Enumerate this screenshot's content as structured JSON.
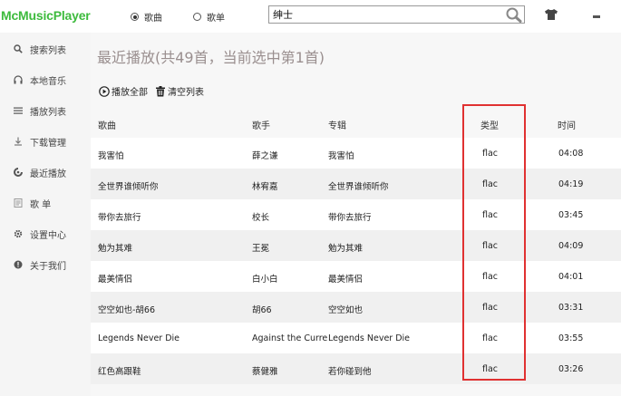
{
  "app": {
    "logo": "McMusicPlayer"
  },
  "search": {
    "mode_song": "歌曲",
    "mode_playlist": "歌单",
    "selected_mode": "song",
    "query": "绅士"
  },
  "sidebar": {
    "items": [
      {
        "label": "搜索列表",
        "icon": "search-icon"
      },
      {
        "label": "本地音乐",
        "icon": "headphones-icon"
      },
      {
        "label": "播放列表",
        "icon": "list-icon"
      },
      {
        "label": "下载管理",
        "icon": "download-icon"
      },
      {
        "label": "最近播放",
        "icon": "recent-icon"
      },
      {
        "label": "歌 单",
        "icon": "playlist-icon"
      },
      {
        "label": "设置中心",
        "icon": "gear-icon"
      },
      {
        "label": "关于我们",
        "icon": "info-icon"
      }
    ]
  },
  "main": {
    "title": "最近播放(共49首，当前选中第1首)",
    "play_all": "播放全部",
    "clear_list": "清空列表",
    "columns": {
      "song": "歌曲",
      "artist": "歌手",
      "album": "专辑",
      "type": "类型",
      "time": "时间"
    },
    "rows": [
      {
        "song": "我害怕",
        "artist": "薛之谦",
        "album": "我害怕",
        "type": "flac",
        "time": "04:08"
      },
      {
        "song": "全世界谁倾听你",
        "artist": "林宥嘉",
        "album": "全世界谁倾听你",
        "type": "flac",
        "time": "04:19"
      },
      {
        "song": "带你去旅行",
        "artist": "校长",
        "album": "带你去旅行",
        "type": "flac",
        "time": "03:45"
      },
      {
        "song": "勉为其难",
        "artist": "王冕",
        "album": "勉为其难",
        "type": "flac",
        "time": "04:09"
      },
      {
        "song": "最美情侣",
        "artist": "白小白",
        "album": "最美情侣",
        "type": "flac",
        "time": "04:01"
      },
      {
        "song": "空空如也-胡66",
        "artist": "胡66",
        "album": "空空如也",
        "type": "flac",
        "time": "03:31"
      },
      {
        "song": "Legends Never Die",
        "artist": "Against the Curre",
        "album": "Legends Never Die",
        "type": "flac",
        "time": "03:55"
      },
      {
        "song": "红色高跟鞋",
        "artist": "蔡健雅",
        "album": "若你碰到他",
        "type": "flac",
        "time": "03:26"
      }
    ]
  },
  "colors": {
    "logo": "#3dbb3d",
    "highlight": "#e03131",
    "title": "#9a8f8f"
  }
}
